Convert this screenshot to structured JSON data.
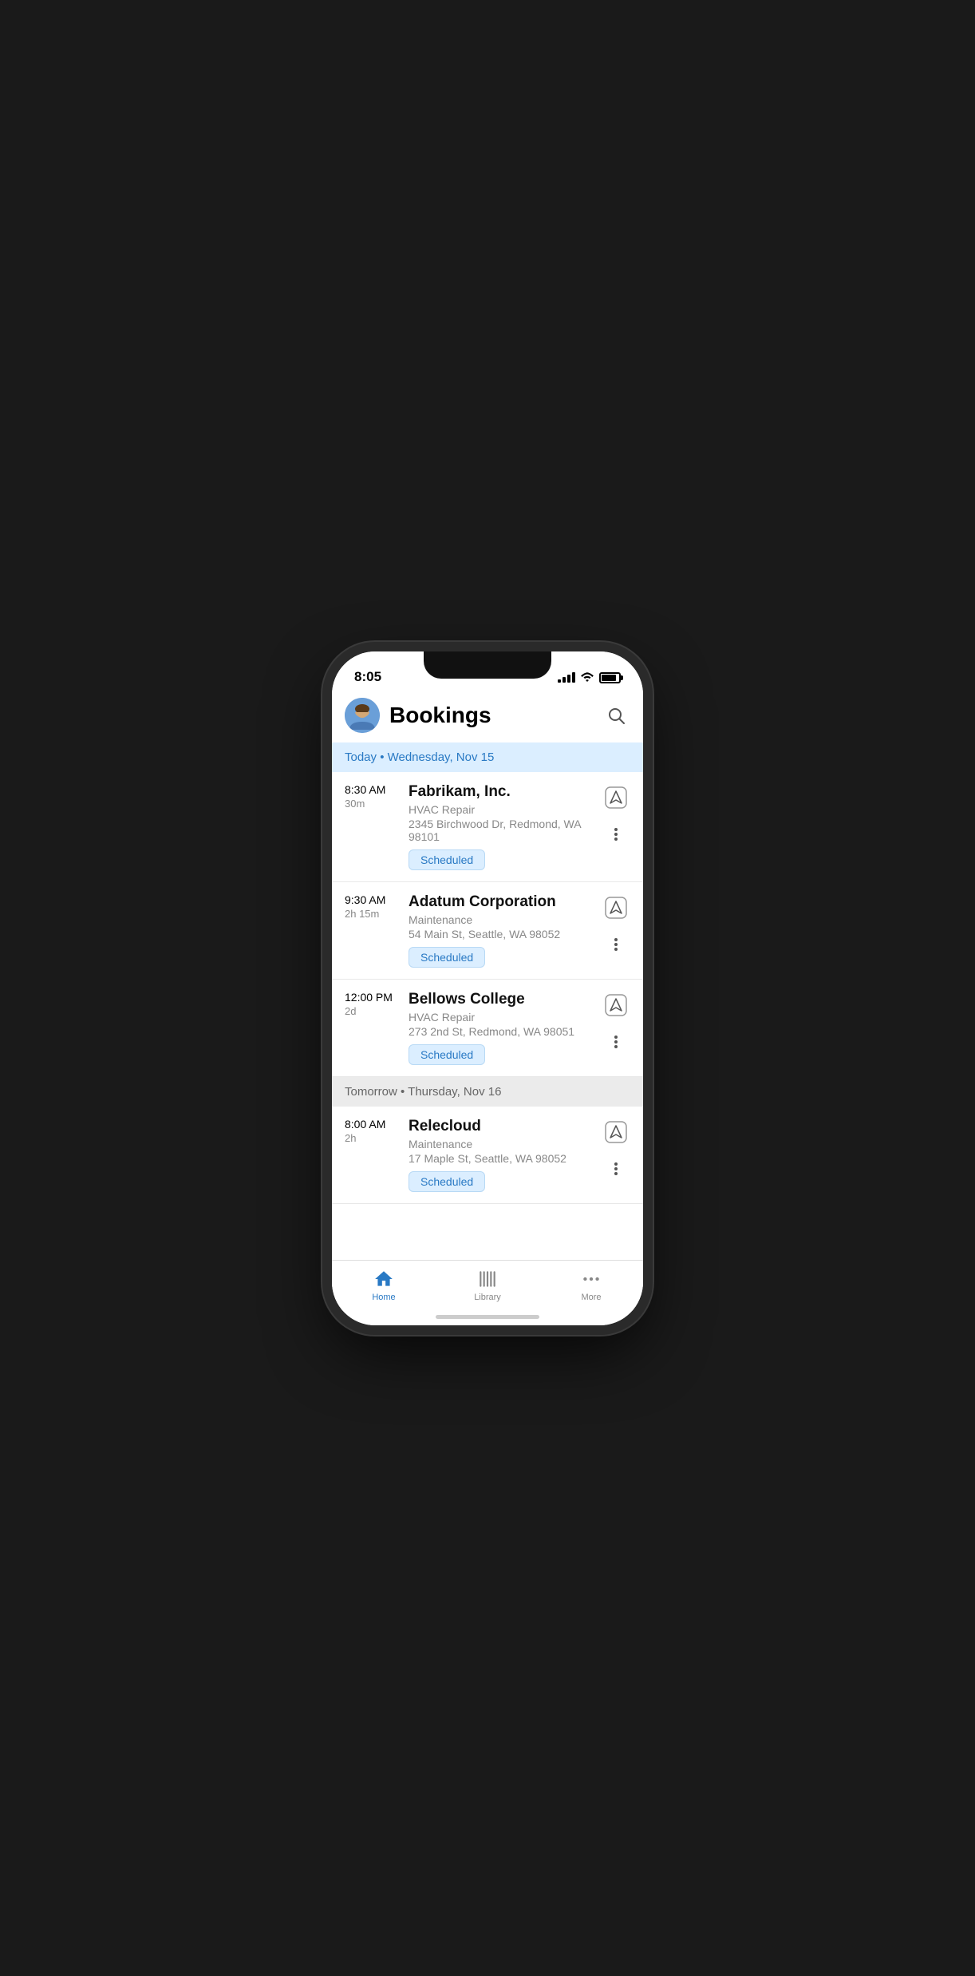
{
  "statusBar": {
    "time": "8:05"
  },
  "header": {
    "title": "Bookings",
    "searchLabel": "Search"
  },
  "dateHeaders": {
    "today": "Today • Wednesday, Nov 15",
    "tomorrow": "Tomorrow • Thursday, Nov 16"
  },
  "bookings": [
    {
      "id": "booking-1",
      "time": "8:30 AM",
      "duration": "30m",
      "name": "Fabrikam, Inc.",
      "service": "HVAC Repair",
      "address": "2345 Birchwood Dr, Redmond, WA 98101",
      "status": "Scheduled",
      "day": "today"
    },
    {
      "id": "booking-2",
      "time": "9:30 AM",
      "duration": "2h 15m",
      "name": "Adatum Corporation",
      "service": "Maintenance",
      "address": "54 Main St, Seattle, WA 98052",
      "status": "Scheduled",
      "day": "today"
    },
    {
      "id": "booking-3",
      "time": "12:00 PM",
      "duration": "2d",
      "name": "Bellows College",
      "service": "HVAC Repair",
      "address": "273 2nd St, Redmond, WA 98051",
      "status": "Scheduled",
      "day": "today"
    },
    {
      "id": "booking-4",
      "time": "8:00 AM",
      "duration": "2h",
      "name": "Relecloud",
      "service": "Maintenance",
      "address": "17 Maple St, Seattle, WA 98052",
      "status": "Scheduled",
      "day": "tomorrow"
    }
  ],
  "tabBar": {
    "tabs": [
      {
        "id": "home",
        "label": "Home",
        "active": true
      },
      {
        "id": "library",
        "label": "Library",
        "active": false
      },
      {
        "id": "more",
        "label": "More",
        "active": false
      }
    ]
  }
}
